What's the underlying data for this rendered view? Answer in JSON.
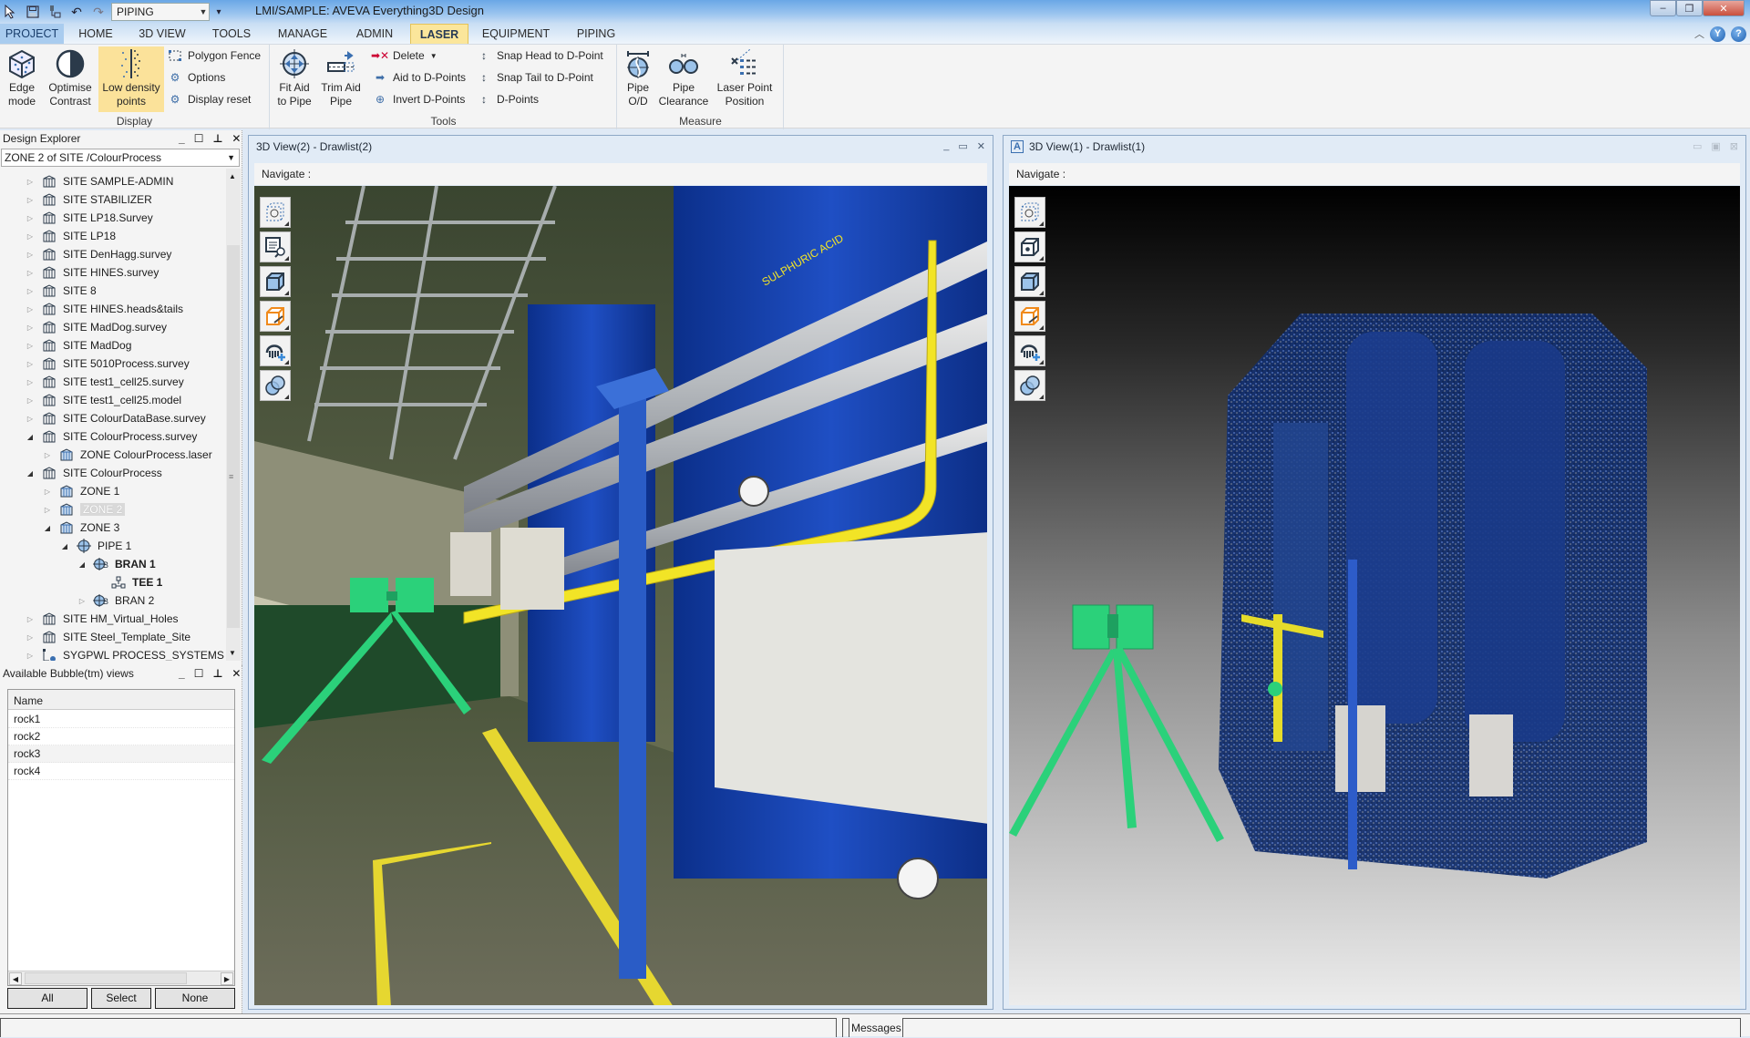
{
  "titlebar": {
    "title": "LMI/SAMPLE: AVEVA Everything3D Design",
    "module": "PIPING",
    "qat_icons": [
      "pointer-icon",
      "save-icon",
      "network-icon",
      "undo-icon",
      "redo-icon"
    ],
    "window_controls": {
      "minimize": "–",
      "restore": "❐",
      "close": "✕"
    }
  },
  "tabs": [
    {
      "label": "PROJECT",
      "state": "file"
    },
    {
      "label": "HOME"
    },
    {
      "label": "3D VIEW"
    },
    {
      "label": "TOOLS"
    },
    {
      "label": "MANAGE"
    },
    {
      "label": "ADMIN"
    },
    {
      "label": "LASER",
      "state": "active"
    },
    {
      "label": "EQUIPMENT"
    },
    {
      "label": "PIPING"
    }
  ],
  "ribbon": {
    "display": {
      "label": "Display",
      "edge_mode": "Edge mode",
      "optimise_contrast": "Optimise Contrast",
      "low_density": "Low density points",
      "polygon_fence": "Polygon Fence",
      "options": "Options",
      "display_reset": "Display reset"
    },
    "tools": {
      "label": "Tools",
      "fit_aid": "Fit Aid to Pipe",
      "trim_aid": "Trim Aid Pipe",
      "delete": "Delete",
      "aid_to_dpoints": "Aid to D-Points",
      "invert_dpoints": "Invert D-Points",
      "snap_head": "Snap Head to D-Point",
      "snap_tail": "Snap Tail to D-Point",
      "dpoints": "D-Points"
    },
    "measure": {
      "label": "Measure",
      "pipe_od": "Pipe O/D",
      "pipe_clearance": "Pipe Clearance",
      "laser_point": "Laser Point Position"
    }
  },
  "design_explorer": {
    "title": "Design Explorer",
    "combo_value": "ZONE 2 of SITE /ColourProcess",
    "tree": [
      {
        "label": "SITE SAMPLE-ADMIN",
        "level": 0,
        "exp": "closed",
        "icon": "site"
      },
      {
        "label": "SITE STABILIZER",
        "level": 0,
        "exp": "closed",
        "icon": "site"
      },
      {
        "label": "SITE LP18.Survey",
        "level": 0,
        "exp": "closed",
        "icon": "site"
      },
      {
        "label": "SITE LP18",
        "level": 0,
        "exp": "closed",
        "icon": "site"
      },
      {
        "label": "SITE DenHagg.survey",
        "level": 0,
        "exp": "closed",
        "icon": "site"
      },
      {
        "label": "SITE HINES.survey",
        "level": 0,
        "exp": "closed",
        "icon": "site"
      },
      {
        "label": "SITE 8",
        "level": 0,
        "exp": "closed",
        "icon": "site"
      },
      {
        "label": "SITE HINES.heads&tails",
        "level": 0,
        "exp": "closed",
        "icon": "site"
      },
      {
        "label": "SITE MadDog.survey",
        "level": 0,
        "exp": "closed",
        "icon": "site"
      },
      {
        "label": "SITE MadDog",
        "level": 0,
        "exp": "closed",
        "icon": "site"
      },
      {
        "label": "SITE 5010Process.survey",
        "level": 0,
        "exp": "closed",
        "icon": "site"
      },
      {
        "label": "SITE test1_cell25.survey",
        "level": 0,
        "exp": "closed",
        "icon": "site"
      },
      {
        "label": "SITE test1_cell25.model",
        "level": 0,
        "exp": "closed",
        "icon": "site"
      },
      {
        "label": "SITE ColourDataBase.survey",
        "level": 0,
        "exp": "closed",
        "icon": "site"
      },
      {
        "label": "SITE ColourProcess.survey",
        "level": 0,
        "exp": "open",
        "icon": "site"
      },
      {
        "label": "ZONE ColourProcess.laser",
        "level": 1,
        "exp": "closed",
        "icon": "zone"
      },
      {
        "label": "SITE ColourProcess",
        "level": 0,
        "exp": "open",
        "icon": "site"
      },
      {
        "label": "ZONE 1",
        "level": 1,
        "exp": "closed",
        "icon": "zone"
      },
      {
        "label": "ZONE 2",
        "level": 1,
        "exp": "closed",
        "icon": "zone",
        "selected": true
      },
      {
        "label": "ZONE 3",
        "level": 1,
        "exp": "open",
        "icon": "zone"
      },
      {
        "label": "PIPE 1",
        "level": 2,
        "exp": "open",
        "icon": "pipe"
      },
      {
        "label": "BRAN 1",
        "level": 3,
        "exp": "open",
        "icon": "bran",
        "bold": true
      },
      {
        "label": "TEE 1",
        "level": 4,
        "exp": "none",
        "icon": "tee",
        "bold": true
      },
      {
        "label": "BRAN 2",
        "level": 3,
        "exp": "closed",
        "icon": "bran"
      },
      {
        "label": "SITE HM_Virtual_Holes",
        "level": 0,
        "exp": "closed",
        "icon": "site"
      },
      {
        "label": "SITE Steel_Template_Site",
        "level": 0,
        "exp": "closed",
        "icon": "site"
      },
      {
        "label": "SYGPWL PROCESS_SYSTEMS",
        "level": 0,
        "exp": "closed",
        "icon": "system"
      }
    ]
  },
  "bubble_views": {
    "title": "Available Bubble(tm) views",
    "column": "Name",
    "rows": [
      "rock1",
      "rock2",
      "rock3",
      "rock4"
    ],
    "buttons": {
      "all": "All",
      "select": "Select",
      "none": "None"
    }
  },
  "view2": {
    "title": "3D View(2) - Drawlist(2)",
    "nav": "Navigate :",
    "labels": {
      "pipe_label": "SULPHURIC ACID"
    }
  },
  "view1": {
    "title": "3D View(1) - Drawlist(1)",
    "nav": "Navigate :"
  },
  "view_tools": [
    "view-cube-icon",
    "search-list-icon",
    "solid-cube-icon",
    "clip-box-icon",
    "point-cloud-add-icon",
    "overlap-circles-icon"
  ],
  "view1_tools": [
    "view-cube-icon",
    "cube-point-icon",
    "solid-cube-icon",
    "clip-box-icon",
    "point-cloud-add-icon",
    "overlap-circles-icon"
  ],
  "statusbar": {
    "messages": "Messages"
  }
}
